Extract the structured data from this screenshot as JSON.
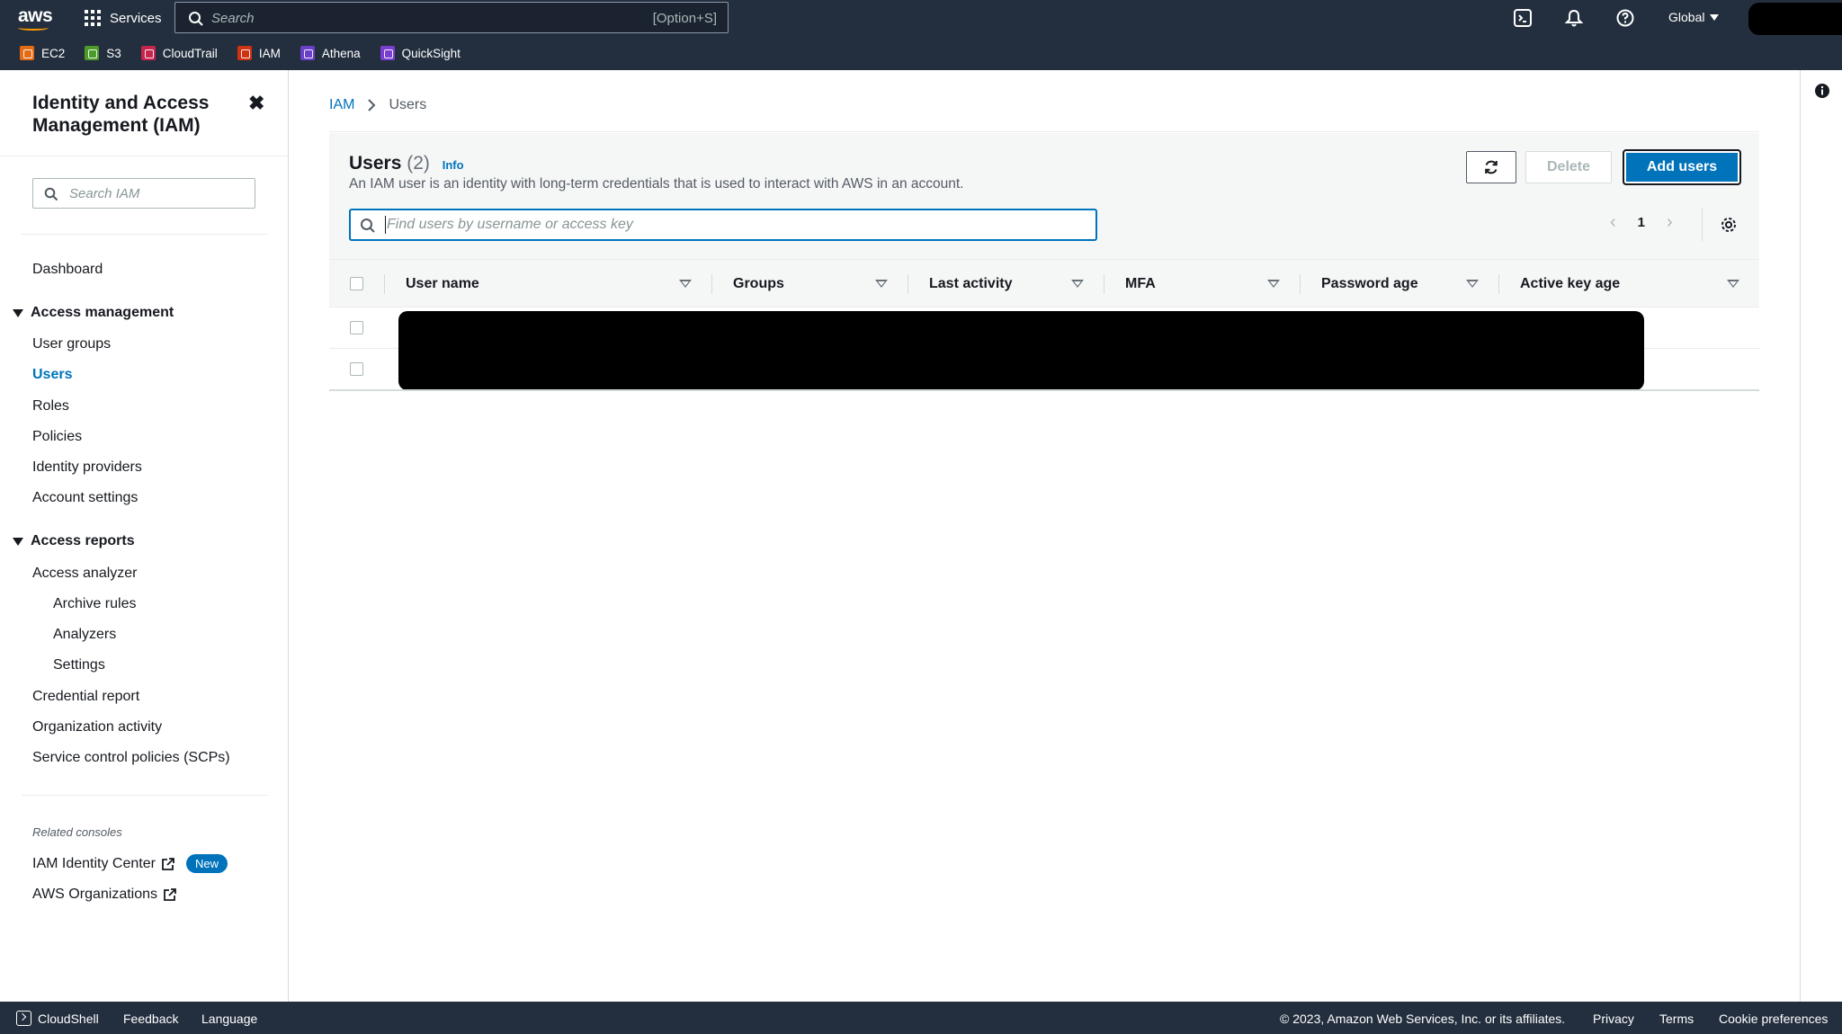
{
  "topnav": {
    "logo": "aws",
    "services_label": "Services",
    "search_placeholder": "Search",
    "search_shortcut": "[Option+S]",
    "region_label": "Global",
    "favorites": [
      {
        "label": "EC2",
        "color": "#e56a14"
      },
      {
        "label": "S3",
        "color": "#4c9a2a"
      },
      {
        "label": "CloudTrail",
        "color": "#c7254e"
      },
      {
        "label": "IAM",
        "color": "#d13212"
      },
      {
        "label": "Athena",
        "color": "#6b40c8"
      },
      {
        "label": "QuickSight",
        "color": "#7a3fd1"
      }
    ],
    "icons": [
      "cloudshell-icon",
      "notifications-icon",
      "help-icon"
    ]
  },
  "sidebar": {
    "title": "Identity and Access Management (IAM)",
    "search_placeholder": "Search IAM",
    "dashboard": "Dashboard",
    "access_management": {
      "heading": "Access management",
      "items": [
        "User groups",
        "Users",
        "Roles",
        "Policies",
        "Identity providers",
        "Account settings"
      ],
      "active": "Users"
    },
    "access_reports": {
      "heading": "Access reports",
      "items": [
        "Access analyzer",
        "Archive rules",
        "Analyzers",
        "Settings",
        "Credential report",
        "Organization activity",
        "Service control policies (SCPs)"
      ]
    },
    "related_heading": "Related consoles",
    "related": [
      {
        "label": "IAM Identity Center",
        "badge": "New"
      },
      {
        "label": "AWS Organizations"
      }
    ]
  },
  "breadcrumb": {
    "root": "IAM",
    "current": "Users"
  },
  "users_panel": {
    "title": "Users",
    "count": "(2)",
    "info": "Info",
    "description": "An IAM user is an identity with long-term credentials that is used to interact with AWS in an account.",
    "delete_label": "Delete",
    "add_label": "Add users",
    "filter_placeholder": "Find users by username or access key",
    "page": "1"
  },
  "table": {
    "columns": [
      "User name",
      "Groups",
      "Last activity",
      "MFA",
      "Password age",
      "Active key age"
    ],
    "rows": 2
  },
  "footer": {
    "cloudshell": "CloudShell",
    "feedback": "Feedback",
    "language": "Language",
    "copyright": "© 2023, Amazon Web Services, Inc. or its affiliates.",
    "privacy": "Privacy",
    "terms": "Terms",
    "cookies": "Cookie preferences"
  },
  "colors": {
    "nav_bg": "#232f3e",
    "link": "#0073bb",
    "accent": "#ff9900"
  }
}
